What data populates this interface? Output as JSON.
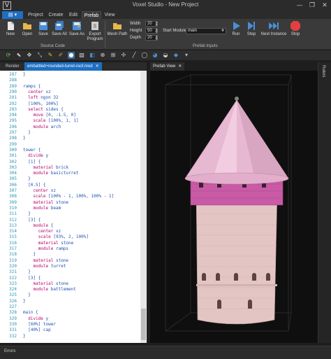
{
  "window": {
    "title": "Voxel Studio - New Project",
    "icon": "V",
    "controls": [
      "—",
      "❐",
      "✕"
    ]
  },
  "menu": {
    "file": "▤ ▾",
    "tabs": [
      "Project",
      "Create",
      "Edit",
      "Prefab",
      "View"
    ],
    "active": "Prefab"
  },
  "ribbon": {
    "buttons": [
      {
        "label": "New",
        "icon": "new-file-icon",
        "color": "#e8e8e8"
      },
      {
        "label": "Open",
        "icon": "open-folder-icon",
        "color": "#e8b84a"
      },
      {
        "label": "Save",
        "icon": "save-icon",
        "color": "#4a8fd6"
      },
      {
        "label": "Save All",
        "icon": "save-all-icon",
        "color": "#4a8fd6"
      },
      {
        "label": "Save As",
        "icon": "save-as-icon",
        "color": "#4a8fd6"
      },
      {
        "label": "Export",
        "label2": "Program",
        "icon": "export-icon",
        "color": "#d0d0d0"
      },
      {
        "label": "Mesh Path",
        "icon": "mesh-path-icon",
        "color": "#e8b84a"
      },
      {
        "label": "Run",
        "icon": "run-icon",
        "color": "#4a8fd6"
      },
      {
        "label": "Step",
        "icon": "step-icon",
        "color": "#4a8fd6"
      },
      {
        "label": "Next Instance",
        "icon": "next-instance-icon",
        "color": "#4a8fd6"
      },
      {
        "label": "Stop",
        "icon": "stop-icon",
        "color": "#e04040"
      }
    ],
    "groups": [
      "Source Code",
      "Prefab Inputs"
    ],
    "inputs": {
      "width_label": "Width",
      "width": "20",
      "height_label": "Height",
      "height": "50",
      "depth_label": "Depth",
      "depth": "20"
    },
    "start_module": {
      "label": "Start Module",
      "value": "main"
    }
  },
  "toolbar": {
    "icons": [
      "refresh-icon",
      "cursor-icon",
      "move-icon",
      "scale-icon",
      "paint-icon",
      "brush-icon",
      "sphere-icon",
      "select-icon",
      "cube-icon",
      "zoom-icon",
      "grid-icon",
      "picker-icon",
      "line-icon",
      "ellipse-icon",
      "fill-icon",
      "bucket-icon",
      "drop-icon",
      "dropdown-icon"
    ],
    "active_index": 6
  },
  "left_panel": {
    "tabs": [
      {
        "label": "Render"
      },
      {
        "label": "embattled+rounded-turret-roof.mod",
        "active": true
      }
    ],
    "close_glyph": "✕",
    "code": [
      {
        "ln": "287",
        "text": "}"
      },
      {
        "ln": "288",
        "text": ""
      },
      {
        "ln": "289",
        "text": "ramps {"
      },
      {
        "ln": "290",
        "text": "  center xz"
      },
      {
        "ln": "291",
        "text": "  loft ngon 32"
      },
      {
        "ln": "292",
        "text": "  [100%, 100%]"
      },
      {
        "ln": "293",
        "text": "  select sides {"
      },
      {
        "ln": "294",
        "text": "    move [0, -1.5, 0]"
      },
      {
        "ln": "295",
        "text": "    scale [100%, 1, 1]"
      },
      {
        "ln": "296",
        "text": "    module arch"
      },
      {
        "ln": "297",
        "text": "  }"
      },
      {
        "ln": "298",
        "text": "}"
      },
      {
        "ln": "299",
        "text": ""
      },
      {
        "ln": "300",
        "text": "tower {"
      },
      {
        "ln": "301",
        "text": "  divide y"
      },
      {
        "ln": "302",
        "text": "  [1] {"
      },
      {
        "ln": "303",
        "text": "    material brick"
      },
      {
        "ln": "304",
        "text": "    module basicturret"
      },
      {
        "ln": "305",
        "text": "  }"
      },
      {
        "ln": "306",
        "text": "  [0.5] {"
      },
      {
        "ln": "307",
        "text": "    center xz"
      },
      {
        "ln": "308",
        "text": "    scale [100% - 1, 100%, 100% - 1]"
      },
      {
        "ln": "309",
        "text": "    material stone"
      },
      {
        "ln": "310",
        "text": "    module beam"
      },
      {
        "ln": "311",
        "text": "  }"
      },
      {
        "ln": "312",
        "text": "  [3] {"
      },
      {
        "ln": "313",
        "text": "    module {"
      },
      {
        "ln": "314",
        "text": "      center xz"
      },
      {
        "ln": "315",
        "text": "      scale [93%, 2, 100%]"
      },
      {
        "ln": "316",
        "text": "      material stone"
      },
      {
        "ln": "317",
        "text": "      module ramps"
      },
      {
        "ln": "318",
        "text": "    }"
      },
      {
        "ln": "319",
        "text": "    material stone"
      },
      {
        "ln": "320",
        "text": "    module turret"
      },
      {
        "ln": "321",
        "text": "  }"
      },
      {
        "ln": "322",
        "text": "  [3] {"
      },
      {
        "ln": "323",
        "text": "    material stone"
      },
      {
        "ln": "324",
        "text": "    module battlement"
      },
      {
        "ln": "325",
        "text": "  }"
      },
      {
        "ln": "326",
        "text": "}"
      },
      {
        "ln": "327",
        "text": ""
      },
      {
        "ln": "328",
        "text": "main {"
      },
      {
        "ln": "329",
        "text": "  divide y"
      },
      {
        "ln": "330",
        "text": "  [60%] tower"
      },
      {
        "ln": "331",
        "text": "  [40%] cap"
      },
      {
        "ln": "332",
        "text": "}"
      }
    ]
  },
  "right_panel": {
    "tab": "Prefab View",
    "close_glyph": "✕"
  },
  "side_strip": {
    "label": "Rulers"
  },
  "bottom": {
    "tab": "Errors"
  },
  "colors": {
    "accent": "#1e6fc3",
    "keyword": "#b5006a",
    "text": "#1f4fb0",
    "line_number": "#2b91af",
    "brick": "#c95aa6",
    "stone": "#e3c6c4",
    "roof": "#e7b8d2"
  }
}
